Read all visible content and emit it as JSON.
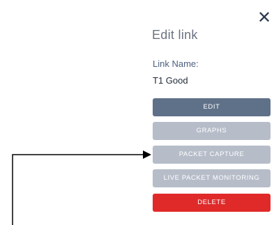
{
  "panel": {
    "title": "Edit link",
    "close_icon": "close-icon",
    "close_symbol": "✕",
    "field_label": "Link Name:",
    "field_value": "T1 Good"
  },
  "buttons": {
    "edit": "EDIT",
    "graphs": "GRAPHS",
    "packet_capture": "PACKET CAPTURE",
    "live_packet_monitoring": "LIVE PACKET MONITORING",
    "delete": "DELETE"
  },
  "colors": {
    "primary_button": "#5f7189",
    "disabled_button": "#b6bdc9",
    "danger_button": "#e02a2a",
    "annotation_arrow": "#000000"
  }
}
